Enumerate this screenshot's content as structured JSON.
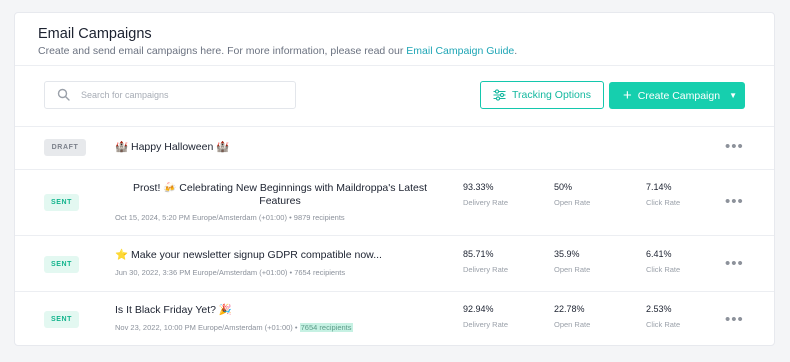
{
  "header": {
    "title": "Email Campaigns",
    "subtitle": "Create and send email campaigns here. For more information, please read our ",
    "guide_link": "Email Campaign Guide",
    "subtitle_end": "."
  },
  "search": {
    "placeholder": "Search for campaigns"
  },
  "toolbar": {
    "tracking_label": "Tracking Options",
    "create_label": "Create Campaign"
  },
  "colors": {
    "accent": "#16cfae",
    "link": "#1ea5b5",
    "sent_badge": "#13b48d"
  },
  "campaigns": [
    {
      "status": "DRAFT",
      "name": "🏰 Happy Halloween 🏰"
    },
    {
      "status": "SENT",
      "name": "Prost! 🍻 Celebrating New Beginnings with Maildroppa's Latest Features",
      "sent_at": "Oct 15, 2024, 5:20 PM Europe/Amsterdam (+01:00)",
      "recipients": "9879 recipients",
      "delivery_rate": "93.33%",
      "open_rate": "50%",
      "click_rate": "7.14%"
    },
    {
      "status": "SENT",
      "name": "⭐ Make your newsletter signup GDPR compatible now...",
      "sent_at": "Jun 30, 2022, 3:36 PM Europe/Amsterdam (+01:00)",
      "recipients": "7654 recipients",
      "delivery_rate": "85.71%",
      "open_rate": "35.9%",
      "click_rate": "6.41%"
    },
    {
      "status": "SENT",
      "name": "Is It Black Friday Yet? 🎉",
      "sent_at": "Nov 23, 2022, 10:00 PM Europe/Amsterdam (+01:00)",
      "recipients": "7654 recipients",
      "delivery_rate": "92.94%",
      "open_rate": "22.78%",
      "click_rate": "2.53%"
    }
  ],
  "labels": {
    "delivery_rate": "Delivery Rate",
    "open_rate": "Open Rate",
    "click_rate": "Click Rate",
    "separator": "•",
    "more": "•••",
    "plus": "+",
    "caret": "▼"
  }
}
